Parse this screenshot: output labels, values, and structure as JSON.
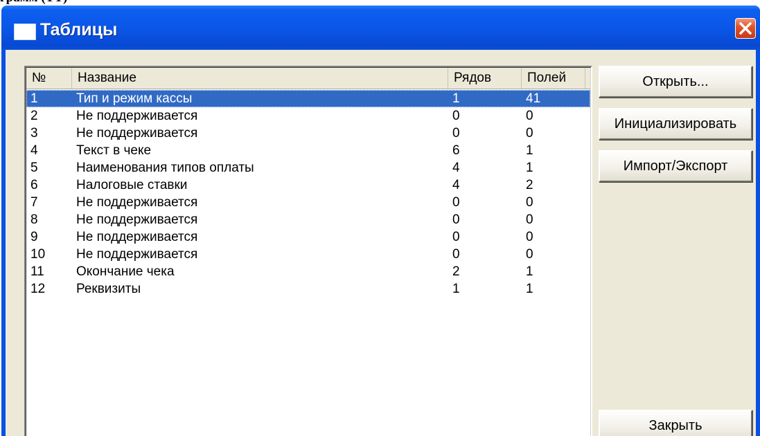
{
  "document_residue": "грамм (ТТ)",
  "window": {
    "title": "Таблицы",
    "title_icon": "window-icon",
    "close_icon": "close-icon",
    "accent_color": "#0a55e6",
    "close_color": "#e0552c"
  },
  "table": {
    "headers": {
      "no": "№",
      "name": "Название",
      "rows": "Рядов",
      "fields": "Полей"
    },
    "rows": [
      {
        "no": "1",
        "name": "Тип и режим кассы",
        "rows": "1",
        "fields": "41"
      },
      {
        "no": "2",
        "name": "Не поддерживается",
        "rows": "0",
        "fields": "0"
      },
      {
        "no": "3",
        "name": "Не поддерживается",
        "rows": "0",
        "fields": "0"
      },
      {
        "no": "4",
        "name": "Текст в чеке",
        "rows": "6",
        "fields": "1"
      },
      {
        "no": "5",
        "name": "Наименования типов оплаты",
        "rows": "4",
        "fields": "1"
      },
      {
        "no": "6",
        "name": "Налоговые ставки",
        "rows": "4",
        "fields": "2"
      },
      {
        "no": "7",
        "name": "Не поддерживается",
        "rows": "0",
        "fields": "0"
      },
      {
        "no": "8",
        "name": "Не поддерживается",
        "rows": "0",
        "fields": "0"
      },
      {
        "no": "9",
        "name": "Не поддерживается",
        "rows": "0",
        "fields": "0"
      },
      {
        "no": "10",
        "name": "Не поддерживается",
        "rows": "0",
        "fields": "0"
      },
      {
        "no": "11",
        "name": "Окончание чека",
        "rows": "2",
        "fields": "1"
      },
      {
        "no": "12",
        "name": "Реквизиты",
        "rows": "1",
        "fields": "1"
      }
    ],
    "selected_row": "1",
    "selection_color": "#316ac5"
  },
  "buttons": {
    "open": "Открыть...",
    "initialize": "Инициализировать",
    "import_export": "Импорт/Экспорт",
    "close": "Закрыть"
  }
}
